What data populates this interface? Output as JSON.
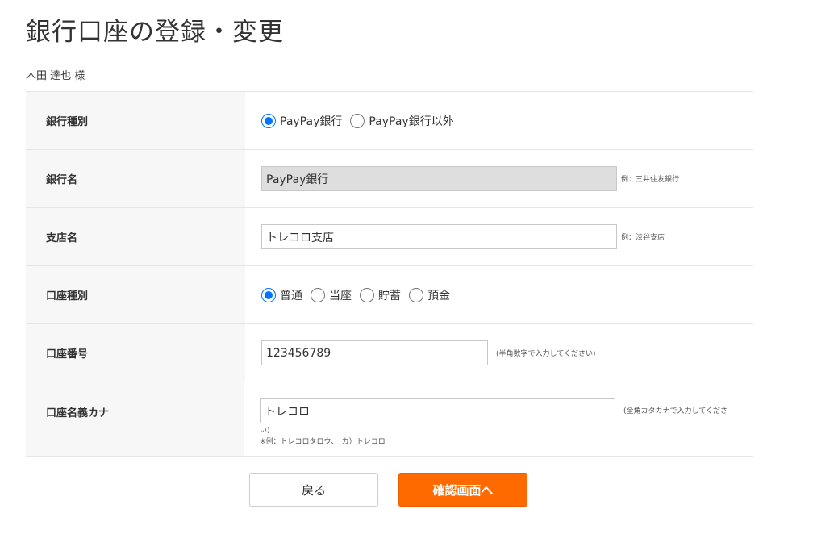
{
  "page": {
    "title": "銀行口座の登録・変更",
    "user_name": "木田 達也 様"
  },
  "form": {
    "bank_type": {
      "label": "銀行種別",
      "options": [
        "PayPay銀行",
        "PayPay銀行以外"
      ],
      "selected": "PayPay銀行"
    },
    "bank_name": {
      "label": "銀行名",
      "value": "PayPay銀行",
      "hint": "例：三井住友銀行"
    },
    "branch_name": {
      "label": "支店名",
      "value": "トレコロ支店",
      "hint": "例：渋谷支店"
    },
    "account_type": {
      "label": "口座種別",
      "options": [
        "普通",
        "当座",
        "貯蓄",
        "預金"
      ],
      "selected": "普通"
    },
    "account_number": {
      "label": "口座番号",
      "value": "123456789",
      "hint": "(半角数字で入力してください)"
    },
    "account_holder_kana": {
      "label": "口座名義カナ",
      "value": "トレコロ",
      "hint_line1": "(全角カタカナで入力してくださ",
      "hint_line2": "い)",
      "example": "※例：トレコロタロウ、　カ）トレコロ"
    }
  },
  "buttons": {
    "back": "戻る",
    "confirm": "確認画面へ"
  },
  "colors": {
    "accent": "#ff6a00",
    "radio_checked": "#0075ff",
    "label_bg": "#f7f7f7",
    "disabled_bg": "#dedede"
  }
}
